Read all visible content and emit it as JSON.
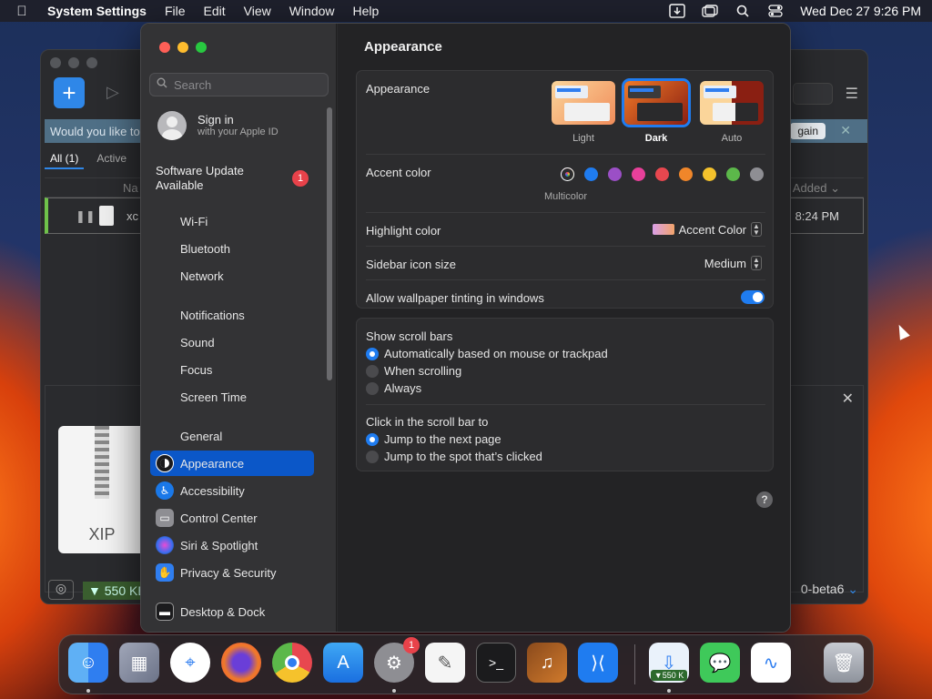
{
  "menubar": {
    "app": "System Settings",
    "menus": [
      "File",
      "Edit",
      "View",
      "Window",
      "Help"
    ],
    "datetime": "Wed Dec 27  9:26 PM"
  },
  "bgwin": {
    "banner_text": "Would you like to",
    "try_again": "gain",
    "tab_all": "All (1)",
    "tab_active": "Active",
    "col_name": "Na",
    "col_added": "Added",
    "row_name": "xc",
    "row_time": "8:24 PM",
    "xip_label": "XIP",
    "speed": "▼ 550 KB",
    "version": "0-beta6"
  },
  "sidebar": {
    "search_placeholder": "Search",
    "signin_title": "Sign in",
    "signin_sub": "with your Apple ID",
    "update_line1": "Software Update",
    "update_line2": "Available",
    "update_badge": "1",
    "items": [
      {
        "label": "Wi-Fi",
        "icon": "wifi-icon",
        "color": "transparent"
      },
      {
        "label": "Bluetooth",
        "icon": "bluetooth-icon",
        "color": "transparent"
      },
      {
        "label": "Network",
        "icon": "network-icon",
        "color": "transparent"
      },
      {
        "label": "Notifications",
        "icon": "notifications-icon",
        "color": "transparent"
      },
      {
        "label": "Sound",
        "icon": "sound-icon",
        "color": "transparent"
      },
      {
        "label": "Focus",
        "icon": "focus-icon",
        "color": "transparent"
      },
      {
        "label": "Screen Time",
        "icon": "screen-time-icon",
        "color": "transparent"
      },
      {
        "label": "General",
        "icon": "general-icon",
        "color": "transparent"
      },
      {
        "label": "Appearance",
        "icon": "appearance-icon",
        "color": "#1b1b1d"
      },
      {
        "label": "Accessibility",
        "icon": "accessibility-icon",
        "color": "#1a78e8"
      },
      {
        "label": "Control Center",
        "icon": "control-center-icon",
        "color": "#8e8e93"
      },
      {
        "label": "Siri & Spotlight",
        "icon": "siri-icon",
        "color": "#9b3fc6"
      },
      {
        "label": "Privacy & Security",
        "icon": "privacy-hand-icon",
        "color": "#2f7ef0"
      },
      {
        "label": "Desktop & Dock",
        "icon": "desktop-dock-icon",
        "color": "#1b1b1d"
      }
    ]
  },
  "content": {
    "title": "Appearance",
    "appearance_label": "Appearance",
    "themes": [
      "Light",
      "Dark",
      "Auto"
    ],
    "selected_theme": "Dark",
    "accent_label": "Accent color",
    "accent_multicolor": "Multicolor",
    "accent_colors": [
      "#1f7cf0",
      "#9b4fc6",
      "#e8409a",
      "#e8474f",
      "#f0862a",
      "#f5c22c",
      "#5cb84a",
      "#8e8e93"
    ],
    "highlight_label": "Highlight color",
    "highlight_value": "Accent Color",
    "sidebar_icon_label": "Sidebar icon size",
    "sidebar_icon_value": "Medium",
    "wallpaper_label": "Allow wallpaper tinting in windows",
    "scrollbars_label": "Show scroll bars",
    "scroll_opts": [
      "Automatically based on mouse or trackpad",
      "When scrolling",
      "Always"
    ],
    "click_label": "Click in the scroll bar to",
    "click_opts": [
      "Jump to the next page",
      "Jump to the spot that’s clicked"
    ]
  },
  "dock": {
    "settings_badge": "1",
    "speed": "▼550 K"
  }
}
